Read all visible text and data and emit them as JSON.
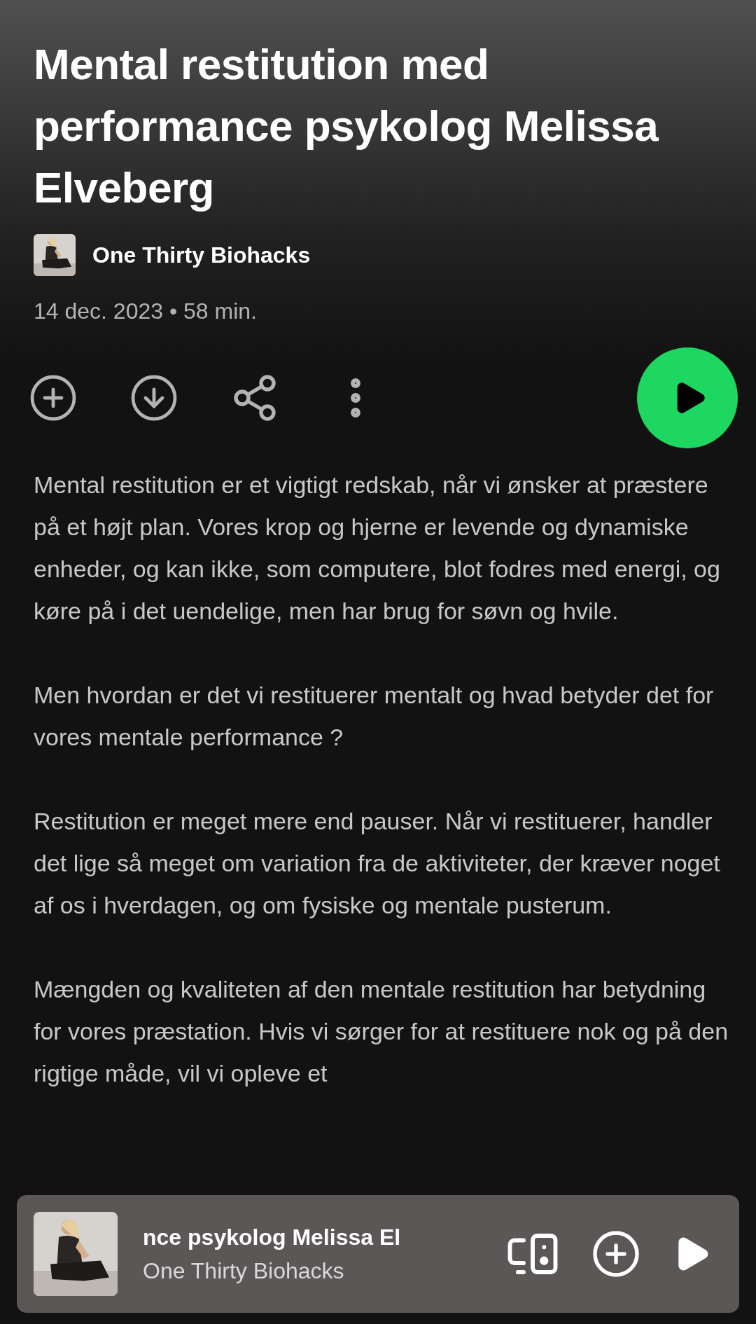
{
  "episode": {
    "title": "Mental restitution med performance psykolog Melissa Elveberg",
    "show": "One Thirty Biohacks",
    "meta": "14 dec. 2023 • 58 min."
  },
  "description": [
    "Mental restitution er et vigtigt redskab, når vi ønsker at præstere på et højt plan. Vores krop og hjerne er levende og dynamiske enheder, og kan ikke, som computere, blot fodres med energi, og køre på i det uendelige, men har brug for søvn og hvile.",
    "Men hvordan er det vi restituerer mentalt og hvad betyder det for vores mentale performance ?",
    "Restitution er meget mere end pauser. Når vi restituerer, handler det lige så meget om variation fra de aktiviteter, der kræver noget af os i hverdagen, og om fysiske og mentale pusterum.",
    "Mængden og kvaliteten af den mentale restitution har betydning for vores præstation. Hvis vi sørger for at restituere nok og på den rigtige måde, vil vi opleve et"
  ],
  "mini_player": {
    "title": "nce psykolog Melissa El",
    "show": "One Thirty Biohacks"
  }
}
